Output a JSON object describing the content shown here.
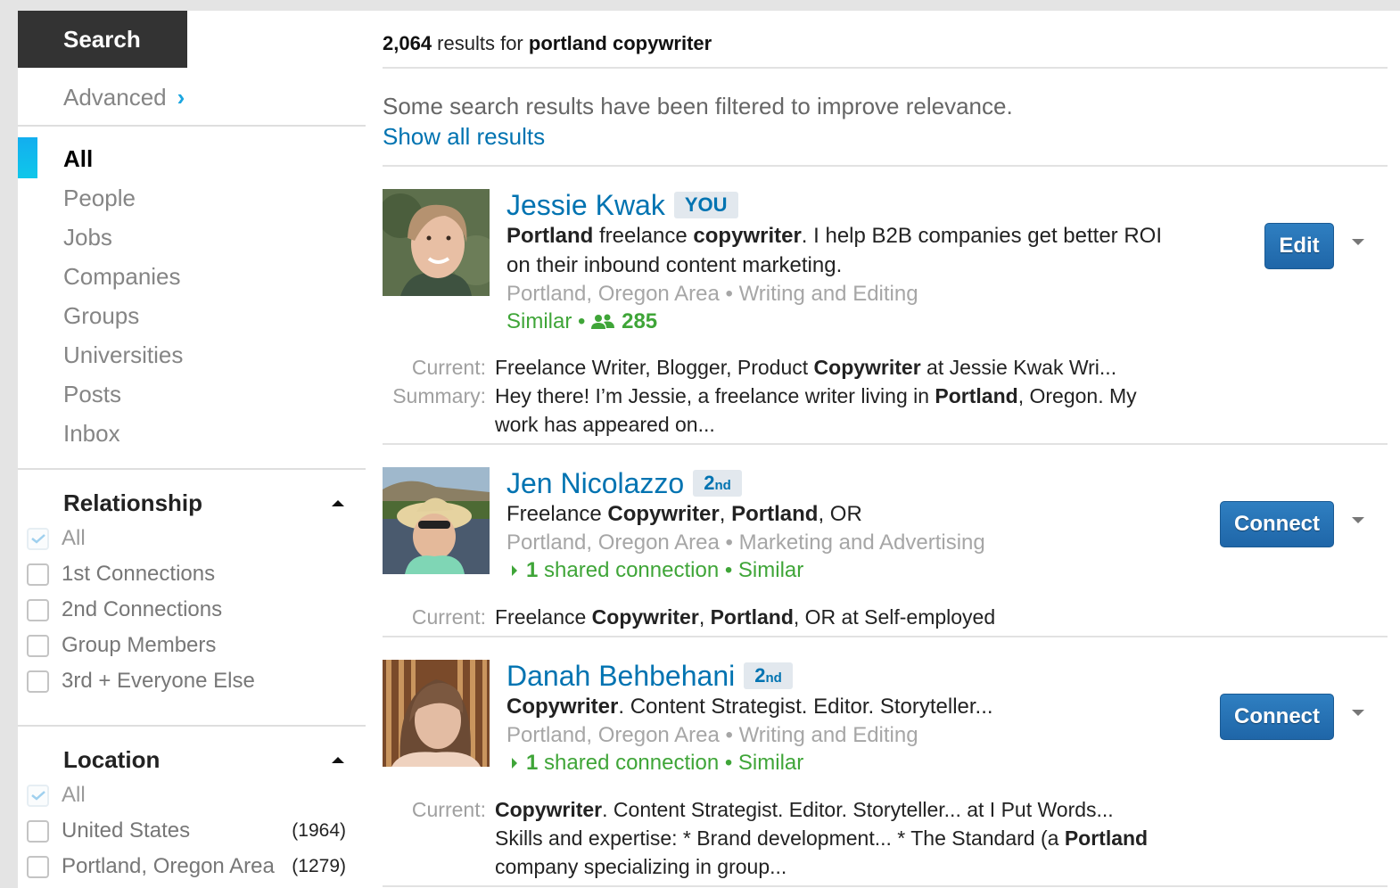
{
  "sidebar": {
    "search_tab": "Search",
    "advanced_link": "Advanced",
    "nav": [
      {
        "label": "All",
        "active": true
      },
      {
        "label": "People"
      },
      {
        "label": "Jobs"
      },
      {
        "label": "Companies"
      },
      {
        "label": "Groups"
      },
      {
        "label": "Universities"
      },
      {
        "label": "Posts"
      },
      {
        "label": "Inbox"
      }
    ],
    "facets": {
      "relationship": {
        "title": "Relationship",
        "options": [
          {
            "label": "All",
            "checked": true
          },
          {
            "label": "1st Connections",
            "checked": false
          },
          {
            "label": "2nd Connections",
            "checked": false
          },
          {
            "label": "Group Members",
            "checked": false
          },
          {
            "label": "3rd + Everyone Else",
            "checked": false
          }
        ]
      },
      "location": {
        "title": "Location",
        "options": [
          {
            "label": "All",
            "checked": true
          },
          {
            "label": "United States",
            "count": "(1964)",
            "checked": false
          },
          {
            "label": "Portland, Oregon Area",
            "count": "(1279)",
            "checked": false
          }
        ]
      }
    }
  },
  "main": {
    "results_count": "2,064",
    "results_for": " results for ",
    "query": "portland copywriter",
    "filtered_note": "Some search results have been filtered to improve relevance.",
    "show_all": "Show all results",
    "results": [
      {
        "name": "Jessie Kwak",
        "badge": "YOU",
        "headline_parts": [
          {
            "b": "Portland"
          },
          {
            "t": " freelance "
          },
          {
            "b": "copywriter"
          },
          {
            "t": ". I help B2B companies get better ROI on their inbound content marketing."
          }
        ],
        "location": "Portland, Oregon Area",
        "industry": "Writing and Editing",
        "similar": "Similar",
        "connections": "285",
        "current_label": "Current:",
        "current_parts": [
          {
            "t": "Freelance Writer, Blogger, Product "
          },
          {
            "b": "Copywriter"
          },
          {
            "t": " at Jessie Kwak Wri..."
          }
        ],
        "summary_label": "Summary:",
        "summary_parts": [
          {
            "t": "Hey there! I’m Jessie, a freelance writer living in "
          },
          {
            "b": "Portland"
          },
          {
            "t": ", Oregon. My work has appeared on..."
          }
        ],
        "action": "Edit"
      },
      {
        "name": "Jen Nicolazzo",
        "badge_num": "2",
        "badge_suffix": "nd",
        "headline_parts": [
          {
            "t": "Freelance "
          },
          {
            "b": "Copywriter"
          },
          {
            "t": ", "
          },
          {
            "b": "Portland"
          },
          {
            "t": ", OR"
          }
        ],
        "location": "Portland, Oregon Area",
        "industry": "Marketing and Advertising",
        "shared": "1",
        "shared_text": " shared connection",
        "similar": "Similar",
        "current_label": "Current:",
        "current_parts": [
          {
            "t": "Freelance "
          },
          {
            "b": "Copywriter"
          },
          {
            "t": ", "
          },
          {
            "b": "Portland"
          },
          {
            "t": ", OR at Self-employed"
          }
        ],
        "action": "Connect"
      },
      {
        "name": "Danah Behbehani",
        "badge_num": "2",
        "badge_suffix": "nd",
        "headline_parts": [
          {
            "b": "Copywriter"
          },
          {
            "t": ". Content Strategist. Editor. Storyteller..."
          }
        ],
        "location": "Portland, Oregon Area",
        "industry": "Writing and Editing",
        "shared": "1",
        "shared_text": " shared connection",
        "similar": "Similar",
        "current_label": "Current:",
        "current_parts": [
          {
            "b": "Copywriter"
          },
          {
            "t": ". Content Strategist. Editor. Storyteller... at I Put Words... Skills and expertise: * Brand development... * The Standard (a "
          },
          {
            "b": "Portland"
          },
          {
            "t": " company specializing in group..."
          }
        ],
        "action": "Connect"
      }
    ]
  },
  "colors": {
    "link_blue": "#0073b1",
    "accent_cyan": "#13aeef",
    "green": "#3fa538",
    "button_blue": "#2870b4",
    "dark_tab": "#333333"
  }
}
